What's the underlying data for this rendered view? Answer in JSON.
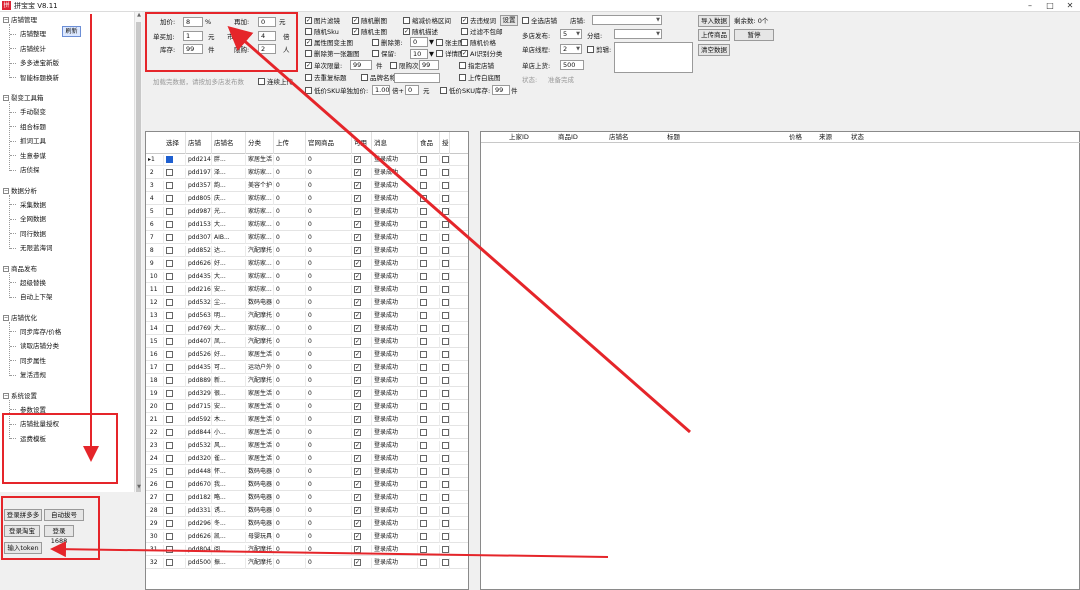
{
  "window": {
    "title": "拼宝宝 V8.11",
    "icon_glyph": "拼"
  },
  "tree": {
    "refresh_label": "刷新",
    "groups": [
      {
        "label": "店铺管理",
        "children": [
          "店铺整理",
          "店铺统计",
          "多多进宝新版",
          "智能标题换新"
        ]
      },
      {
        "label": "裂变工具箱",
        "children": [
          "手动裂变",
          "组合标题",
          "抓词工具",
          "生意参谋",
          "店侦探"
        ]
      },
      {
        "label": "数据分析",
        "children": [
          "采集数据",
          "全网数据",
          "同行数据",
          "无限蓝海词"
        ]
      },
      {
        "label": "商品发布",
        "children": [
          "超级替换",
          "自动上下架"
        ]
      },
      {
        "label": "店铺优化",
        "children": [
          "同步库存/价格",
          "读取店铺分类",
          "同步属性",
          "复活违规"
        ]
      },
      {
        "label": "系统设置",
        "children": [
          "参数设置",
          "店铺批量授权",
          "运费模板"
        ]
      }
    ]
  },
  "login": {
    "pdd": "登录拼多多",
    "auto_account": "自动拔号",
    "taobao": "登录淘宝",
    "ali1688": "登录1688",
    "token": "输入token"
  },
  "params": {
    "add_price_label": "加价:",
    "add_price_value": "8",
    "add_price_unit": "%",
    "plus_label": "再加:",
    "plus_value": "0",
    "plus_unit": "元",
    "unit_add_label": "单买加:",
    "unit_add_value": "1",
    "unit_add_unit": "元",
    "market_label": "市场价:",
    "market_value": "4",
    "market_unit": "倍",
    "stock_label": "库存:",
    "stock_value": "99",
    "stock_unit": "件",
    "limit_label": "限购:",
    "limit_value": "2",
    "limit_unit": "人",
    "hint": "加载完数据，请按加多店发布数",
    "continuous_label": "连续上传"
  },
  "options": {
    "col1": [
      {
        "label": "图片滤镜",
        "checked": true
      },
      {
        "label": "随机Sku",
        "checked": false
      },
      {
        "label": "属性图变主图",
        "checked": true
      },
      {
        "label": "删除第一张趣图",
        "checked": false
      },
      {
        "label": "单次限量:",
        "checked": true
      },
      {
        "label": "去重复标题",
        "checked": false
      },
      {
        "label": "低价SKU单独加价:",
        "checked": false
      }
    ],
    "col2": [
      {
        "label": "随机删图",
        "checked": true
      },
      {
        "label": "随机主图",
        "checked": true
      },
      {
        "label": "删除第:",
        "checked": false
      },
      {
        "label": "保留:",
        "checked": false
      },
      {
        "label": "品牌名称",
        "checked": false
      }
    ],
    "col3": [
      {
        "label": "缩减价格区间",
        "checked": false
      },
      {
        "label": "随机描述",
        "checked": true
      },
      {
        "label": "张主图",
        "checked": false
      },
      {
        "label": "详情图",
        "checked": false
      },
      {
        "label": "限购次数:",
        "checked": false
      }
    ],
    "col4": [
      {
        "label": "去违规词",
        "checked": true
      },
      {
        "label": "过滤不包邮",
        "checked": false
      },
      {
        "label": "随机价格",
        "checked": false
      },
      {
        "label": "AI识别分类",
        "checked": true
      },
      {
        "label": "指定店铺",
        "checked": false
      },
      {
        "label": "上传白底图",
        "checked": false
      },
      {
        "label": "低价SKU库存:",
        "checked": false
      }
    ],
    "delete_no": "0",
    "keep_no": "10",
    "single_limit": "99",
    "single_limit_unit": "件",
    "limit_times": "99",
    "low_add_times": "1.00",
    "low_add_times_unit": "倍+",
    "low_add_plus": "0",
    "low_add_plus_unit": "元",
    "low_stock": "99",
    "low_stock_unit": "件",
    "settings_btn": "设置"
  },
  "stores": {
    "all_label": "全选店铺",
    "store_label": "店铺:",
    "multi_label": "多店发布:",
    "multi_value": "5",
    "group_label": "分组:",
    "threads_label": "单店线程:",
    "threads_value": "2",
    "cut_label": "剪辑:",
    "upload_label": "单店上货:",
    "upload_value": "500",
    "status_label": "状态:",
    "status_value": "准备完成"
  },
  "actions": {
    "import": "导入数据",
    "remaining": "剩余数: 0个",
    "upload": "上传商品",
    "pause": "暂停",
    "clear": "清空数据"
  },
  "table": {
    "headers": [
      "选择",
      "店铺",
      "店铺名",
      "分类",
      "上传",
      "官网商品",
      "可用",
      "消息",
      "食品",
      "授"
    ],
    "rows": [
      [
        "1",
        "pdd21434...",
        "胖...",
        "家居生活",
        "0",
        "0",
        "登录成功"
      ],
      [
        "2",
        "pdd19728...",
        "泽...",
        "家纺家...",
        "0",
        "0",
        "登录成功"
      ],
      [
        "3",
        "pdd35719...",
        "韵...",
        "美容个护",
        "0",
        "0",
        "登录成功"
      ],
      [
        "4",
        "pdd80508...",
        "庆...",
        "家纺家...",
        "0",
        "0",
        "登录成功"
      ],
      [
        "5",
        "pdd98795...",
        "光...",
        "家纺家...",
        "0",
        "0",
        "登录成功"
      ],
      [
        "6",
        "pdd15318...",
        "大...",
        "家纺家...",
        "0",
        "0",
        "登录成功"
      ],
      [
        "7",
        "pdd30754...",
        "AIB...",
        "家纺家...",
        "0",
        "0",
        "登录成功"
      ],
      [
        "8",
        "pdd85298...",
        "达...",
        "汽配摩托",
        "0",
        "0",
        "登录成功"
      ],
      [
        "9",
        "pdd62649...",
        "好...",
        "家纺家...",
        "0",
        "0",
        "登录成功"
      ],
      [
        "10",
        "pdd43502...",
        "大...",
        "家纺家...",
        "0",
        "0",
        "登录成功"
      ],
      [
        "11",
        "pdd21613...",
        "安...",
        "家纺家...",
        "0",
        "0",
        "登录成功"
      ],
      [
        "12",
        "pdd53217...",
        "尘...",
        "数码电器",
        "0",
        "0",
        "登录成功"
      ],
      [
        "13",
        "pdd56380...",
        "明...",
        "汽配摩托",
        "0",
        "0",
        "登录成功"
      ],
      [
        "14",
        "pdd76908...",
        "大...",
        "家纺家...",
        "0",
        "0",
        "登录成功"
      ],
      [
        "15",
        "pdd40710...",
        "凤...",
        "汽配摩托",
        "0",
        "0",
        "登录成功"
      ],
      [
        "16",
        "pdd52663...",
        "好...",
        "家居生活",
        "0",
        "0",
        "登录成功"
      ],
      [
        "17",
        "pdd43592...",
        "可...",
        "运动户外",
        "0",
        "0",
        "登录成功"
      ],
      [
        "18",
        "pdd88991...",
        "新...",
        "汽配摩托",
        "0",
        "0",
        "登录成功"
      ],
      [
        "19",
        "pdd32949...",
        "很...",
        "家居生活",
        "0",
        "0",
        "登录成功"
      ],
      [
        "20",
        "pdd71541...",
        "安...",
        "家居生活",
        "0",
        "0",
        "登录成功"
      ],
      [
        "21",
        "pdd59217...",
        "木...",
        "家居生活",
        "0",
        "0",
        "登录成功"
      ],
      [
        "22",
        "pdd84405...",
        "小...",
        "家居生活",
        "0",
        "0",
        "登录成功"
      ],
      [
        "23",
        "pdd53298...",
        "风...",
        "家居生活",
        "0",
        "0",
        "登录成功"
      ],
      [
        "24",
        "pdd32032...",
        "雀...",
        "家居生活",
        "0",
        "0",
        "登录成功"
      ],
      [
        "25",
        "pdd44813...",
        "怀...",
        "数码电器",
        "0",
        "0",
        "登录成功"
      ],
      [
        "26",
        "pdd67088...",
        "我...",
        "数码电器",
        "0",
        "0",
        "登录成功"
      ],
      [
        "27",
        "pdd18276...",
        "略...",
        "数码电器",
        "0",
        "0",
        "登录成功"
      ],
      [
        "28",
        "pdd33159...",
        "诱...",
        "数码电器",
        "0",
        "0",
        "登录成功"
      ],
      [
        "29",
        "pdd29634...",
        "冬...",
        "数码电器",
        "0",
        "0",
        "登录成功"
      ],
      [
        "30",
        "pdd62643...",
        "凯...",
        "母婴玩具",
        "0",
        "0",
        "登录成功"
      ],
      [
        "31",
        "pdd80475...",
        "阅...",
        "汽配摩托",
        "0",
        "0",
        "登录成功"
      ],
      [
        "32",
        "pdd50078...",
        "振...",
        "汽配摩托",
        "0",
        "0",
        "登录成功"
      ]
    ]
  },
  "right_table": {
    "headers": [
      "上家ID",
      "商品ID",
      "店铺名",
      "标题",
      "价格",
      "来源",
      "状态"
    ]
  },
  "colors": {
    "highlight": "#e5252a",
    "selected_row_marker": "#1e5fd0"
  }
}
